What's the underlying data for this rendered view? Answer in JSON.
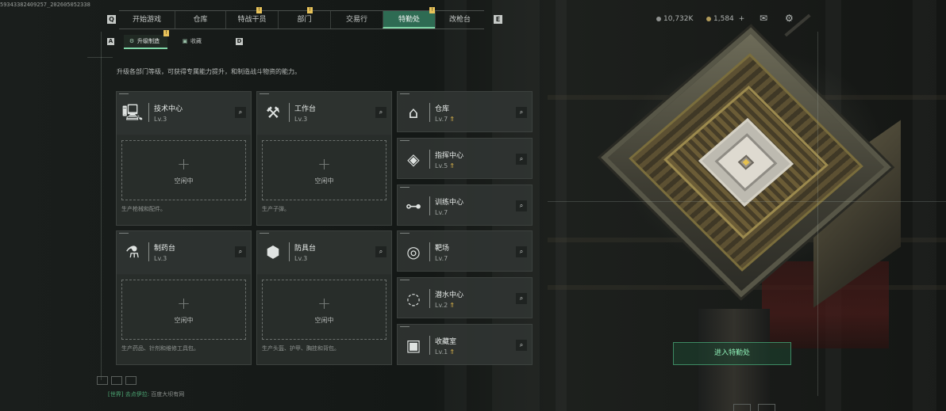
{
  "build_id": "59343382409257_202605052338",
  "nav": {
    "tabs": [
      {
        "label": "开始游戏",
        "badge": ""
      },
      {
        "label": "仓库",
        "badge": ""
      },
      {
        "label": "特战干员",
        "badge": "!"
      },
      {
        "label": "部门",
        "badge": "!"
      },
      {
        "label": "交易行",
        "badge": ""
      },
      {
        "label": "特勤处",
        "badge": "!",
        "active": true
      },
      {
        "label": "改枪台",
        "badge": ""
      }
    ],
    "prev_key": "Q",
    "next_key": "E"
  },
  "subnav": {
    "tabs": [
      {
        "label": "升级制造",
        "badge": "!",
        "active": true
      },
      {
        "label": "收藏",
        "badge": ""
      }
    ],
    "prev_key": "A",
    "next_key": "D"
  },
  "currency": {
    "coins": "10,732K",
    "points": "1,584",
    "plus": "+"
  },
  "intro_text": "升级各部门等级，可获得专属能力提升，和制造战斗物资的能力。",
  "buildings_with_slot": [
    {
      "name": "技术中心",
      "level": "Lv.3",
      "idle": "空闲中",
      "desc": "生产枪械和配件。"
    },
    {
      "name": "工作台",
      "level": "Lv.3",
      "idle": "空闲中",
      "desc": "生产子弹。"
    },
    {
      "name": "制药台",
      "level": "Lv.3",
      "idle": "空闲中",
      "desc": "生产药品、针剂和维修工具包。"
    },
    {
      "name": "防具台",
      "level": "Lv.3",
      "idle": "空闲中",
      "desc": "生产头盔、护甲、胸挂和背包。"
    }
  ],
  "buildings_small": [
    {
      "name": "仓库",
      "level": "Lv.7",
      "upgrade": true
    },
    {
      "name": "指挥中心",
      "level": "Lv.5",
      "upgrade": true
    },
    {
      "name": "训练中心",
      "level": "Lv.7",
      "upgrade": false
    },
    {
      "name": "靶场",
      "level": "Lv.7",
      "upgrade": false
    },
    {
      "name": "潜水中心",
      "level": "Lv.2",
      "upgrade": true
    },
    {
      "name": "收藏室",
      "level": "Lv.1",
      "upgrade": true
    }
  ],
  "enter_button": "进入特勤处",
  "chat": {
    "channel": "[世界]",
    "user": "去点伊拉:",
    "message": "百度大坝有网"
  },
  "icons": {
    "search": "search-icon",
    "mail": "mail-icon",
    "settings": "gear-icon"
  },
  "colors": {
    "accent": "#2e6b53",
    "accent_line": "#7fd6a6",
    "badge": "#e8c35a",
    "upgrade_arrow": "#e0b84c"
  }
}
